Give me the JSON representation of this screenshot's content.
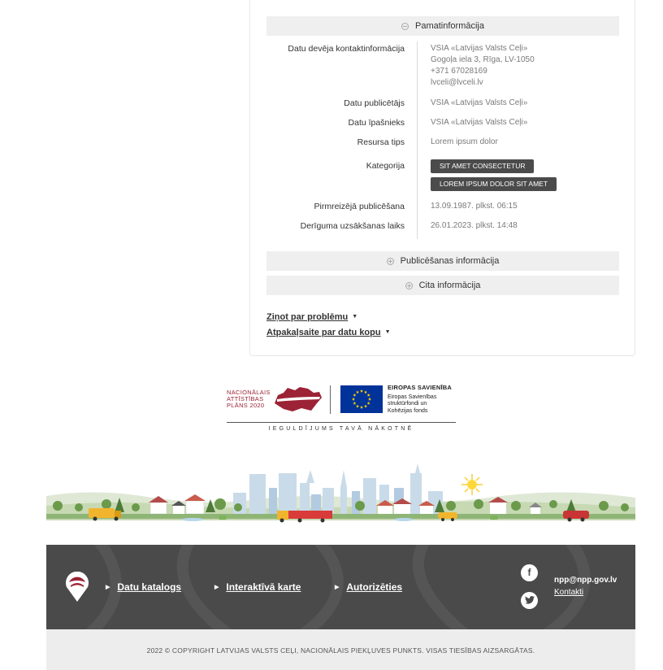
{
  "sections": {
    "basic": "Pamatinformācija",
    "publishing": "Publicēšanas informācija",
    "other": "Cita informācija"
  },
  "fields": {
    "contact": {
      "label": "Datu devēja kontaktinformācija",
      "lines": [
        "VSIA «Latvijas Valsts Ceļi»",
        "Gogoļa iela 3, Rīga, LV-1050",
        "+371 67028169",
        "lvceli@lvceli.lv"
      ]
    },
    "publisher": {
      "label": "Datu publicētājs",
      "value": "VSIA «Latvijas Valsts Ceļi»"
    },
    "owner": {
      "label": "Datu īpašnieks",
      "value": "VSIA «Latvijas Valsts Ceļi»"
    },
    "resource_type": {
      "label": "Resursa tips",
      "value": "Lorem ipsum dolor"
    },
    "category": {
      "label": "Kategorija",
      "tags": [
        "SIT AMET CONSECTETUR",
        "LOREM IPSUM DOLOR SIT AMET"
      ]
    },
    "first_published": {
      "label": "Pirmreizējā publicēšana",
      "value": "13.09.1987. plkst. 06:15"
    },
    "valid_from": {
      "label": "Derīguma uzsākšanas laiks",
      "value": "26.01.2023. plkst. 14:48"
    }
  },
  "links": {
    "report": "Ziņot par problēmu",
    "feedback": "Atpakaļsaite par datu kopu",
    "caret": "▼"
  },
  "logos": {
    "nap": [
      "NACIONĀLAIS",
      "ATTĪSTĪBAS",
      "PLĀNS 2020"
    ],
    "eu": [
      "EIROPAS SAVIENĪBA",
      "Eiropas Savienības",
      "struktūrfondi un",
      "Kohēzijas fonds"
    ],
    "motto": "IEGULDĪJUMS TAVĀ NĀKOTNĒ"
  },
  "footer": {
    "nav": [
      "Datu katalogs",
      "Interaktīvā karte",
      "Autorizēties"
    ],
    "nav_arrow": "▶",
    "social": [
      "f",
      "t"
    ],
    "email": "npp@npp.gov.lv",
    "contact": "Kontakti",
    "copyright": "2022 © COPYRIGHT LATVIJAS VALSTS CEĻI, NACIONĀLAIS PIEKĻUVES PUNKTS. VISAS TIESĪBAS AIZSARGĀTAS."
  },
  "colors": {
    "accent_red": "#9b2335",
    "footer_bg": "#4a4a4a",
    "tag_bg": "#4b4b4b",
    "eu_blue": "#003399",
    "eu_star": "#ffcc00"
  }
}
